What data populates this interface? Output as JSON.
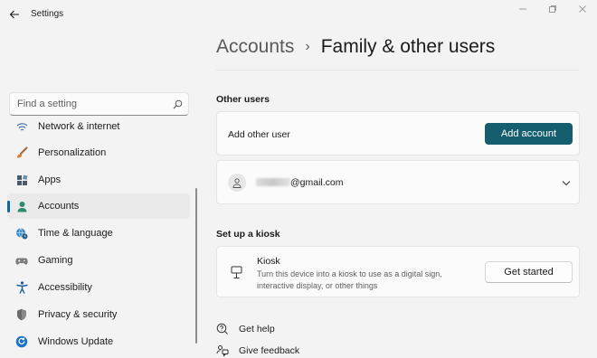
{
  "window": {
    "title": "Settings"
  },
  "sidebar": {
    "search_placeholder": "Find a setting",
    "items": [
      {
        "label": "Network & internet",
        "icon": "network-icon"
      },
      {
        "label": "Personalization",
        "icon": "brush-icon"
      },
      {
        "label": "Apps",
        "icon": "apps-icon"
      },
      {
        "label": "Accounts",
        "icon": "person-icon",
        "active": true
      },
      {
        "label": "Time & language",
        "icon": "globe-clock-icon"
      },
      {
        "label": "Gaming",
        "icon": "gamepad-icon"
      },
      {
        "label": "Accessibility",
        "icon": "accessibility-icon"
      },
      {
        "label": "Privacy & security",
        "icon": "shield-icon"
      },
      {
        "label": "Windows Update",
        "icon": "update-icon"
      }
    ]
  },
  "breadcrumb": {
    "parent": "Accounts",
    "separator": "›",
    "current": "Family & other users"
  },
  "other_users": {
    "title": "Other users",
    "add_label": "Add other user",
    "add_button": "Add account",
    "user_email": "@gmail.com"
  },
  "kiosk": {
    "title": "Set up a kiosk",
    "name": "Kiosk",
    "description": "Turn this device into a kiosk to use as a digital sign, interactive display, or other things",
    "button": "Get started"
  },
  "links": {
    "help": "Get help",
    "feedback": "Give feedback"
  },
  "colors": {
    "accent": "#155e6e",
    "nav_indicator": "#0b6a9b",
    "background": "#f3f3f3",
    "card": "#fbfbfb"
  }
}
